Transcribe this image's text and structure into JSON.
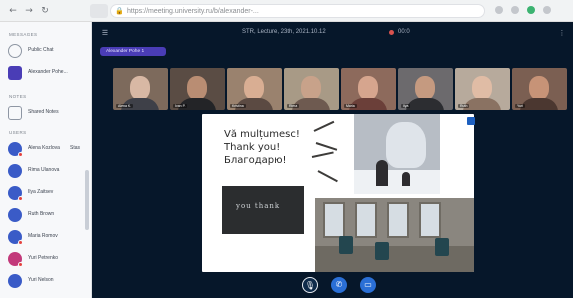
{
  "browser": {
    "url": "https://meeting.university.ru/b/alexander-...",
    "colors": {
      "brand": "#4a3db6",
      "call_dark": "#06172a",
      "accent_blue": "#1d5fbf"
    }
  },
  "sidebar": {
    "sections": [
      {
        "title": "Messages"
      },
      {
        "title": "Notes"
      },
      {
        "title": "Users"
      }
    ],
    "items": [
      {
        "label": "Public Chat"
      },
      {
        "label": "Alexander Pohe..."
      },
      {
        "label": "Shared Notes"
      },
      {
        "label": "Alena Kozlova",
        "extra": "Stas"
      },
      {
        "label": "Rima Ulanova"
      },
      {
        "label": "Ilya Zaitsev"
      },
      {
        "label": "Ruth Brown"
      },
      {
        "label": "Maria Romov"
      },
      {
        "label": "Yuri Petrenko"
      },
      {
        "label": "Yuri Nelson"
      }
    ]
  },
  "meeting": {
    "title": "STR, Lecture, 23th, 2021.10.12",
    "timer": "00:0",
    "presenter_pill": "Alexander Pohe 1"
  },
  "participants": [
    {
      "name": "Alena K."
    },
    {
      "name": "Ivan P."
    },
    {
      "name": "Kristina"
    },
    {
      "name": "Rima"
    },
    {
      "name": "Maria"
    },
    {
      "name": "Ilya"
    },
    {
      "name": "Ruth"
    },
    {
      "name": "Yuri"
    }
  ],
  "slide": {
    "lines": [
      "Vă mulțumesc!",
      "Thank you!",
      "Благодарю!"
    ],
    "chalkboard_text": "you thank"
  },
  "controls": [
    {
      "icon": "microphone-icon"
    },
    {
      "icon": "phone-icon"
    },
    {
      "icon": "screen-share-icon"
    }
  ]
}
